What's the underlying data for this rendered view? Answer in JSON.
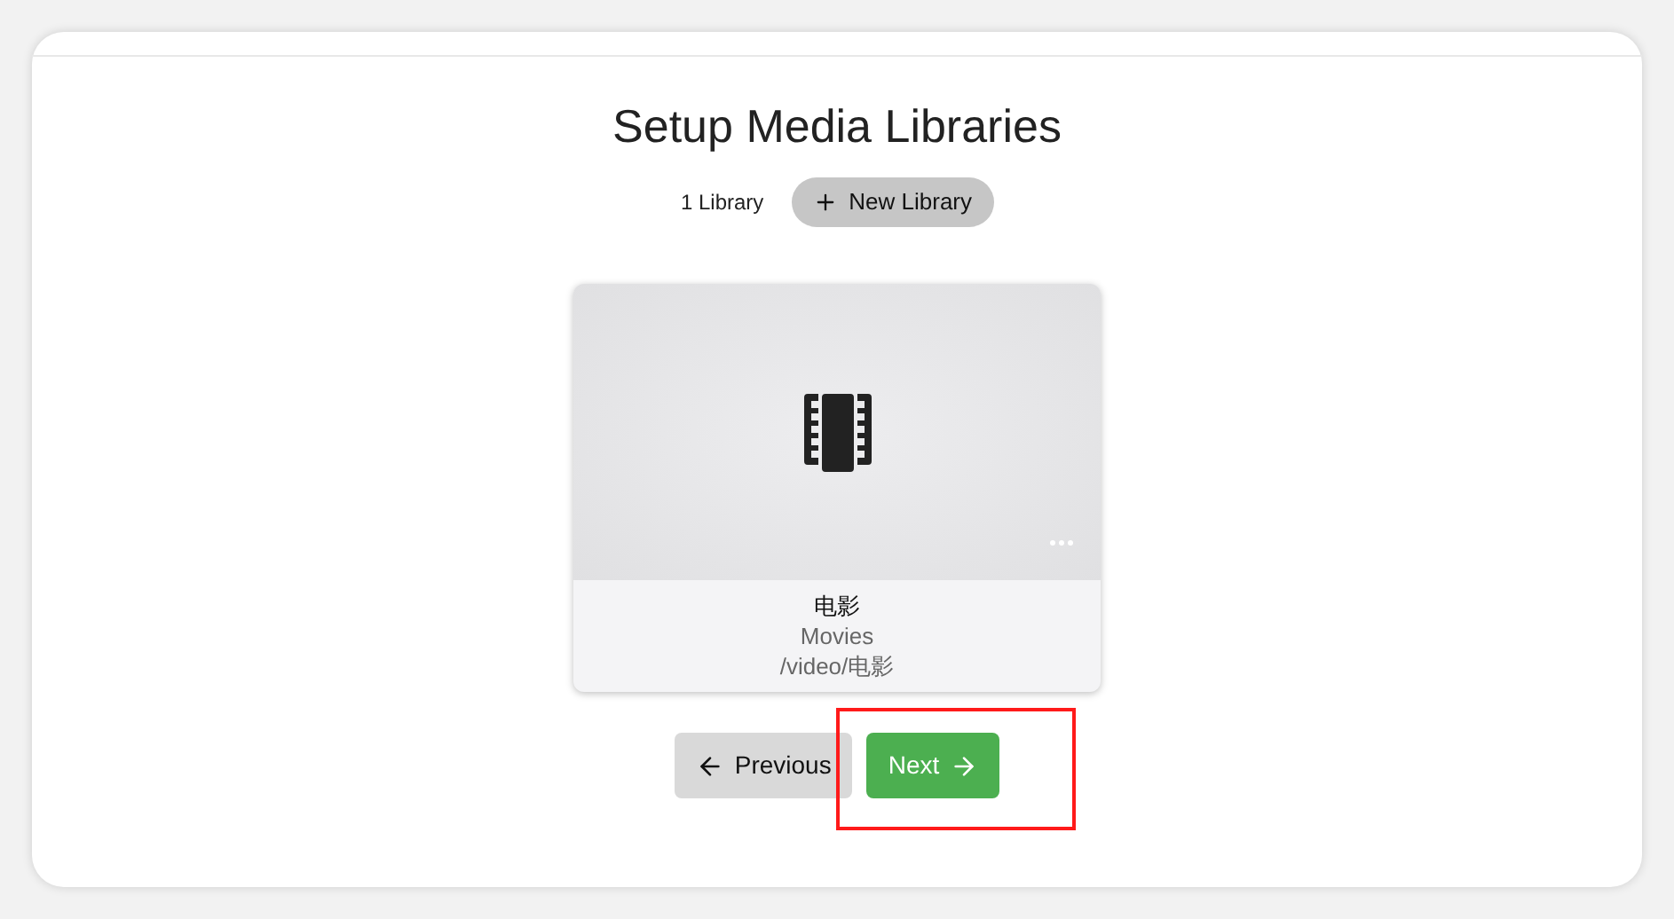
{
  "title": "Setup Media Libraries",
  "library_count": "1 Library",
  "new_library_button": {
    "label": "New Library"
  },
  "libraries": [
    {
      "name": "电影",
      "type": "Movies",
      "path": "/video/电影",
      "kind": "movies"
    }
  ],
  "buttons": [
    {
      "label": "Previous",
      "kind": "previous",
      "highlighted": false
    },
    {
      "label": "Next",
      "kind": "next",
      "highlighted": true
    }
  ]
}
